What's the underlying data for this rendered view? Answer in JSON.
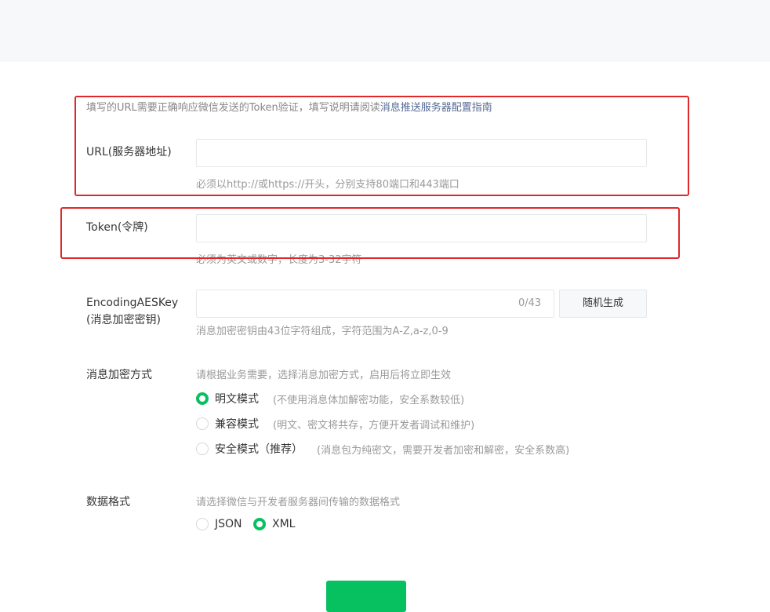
{
  "intro": {
    "text": "填写的URL需要正确响应微信发送的Token验证，填写说明请阅读",
    "link": "消息推送服务器配置指南"
  },
  "url_field": {
    "label": "URL(服务器地址)",
    "value": "",
    "hint": "必须以http://或https://开头，分别支持80端口和443端口"
  },
  "token_field": {
    "label": "Token(令牌)",
    "value": "",
    "hint": "必须为英文或数字，长度为3-32字符"
  },
  "aes_field": {
    "label_line1": "EncodingAESKey",
    "label_line2": "(消息加密密钥)",
    "value": "",
    "counter": "0/43",
    "generate_label": "随机生成",
    "hint": "消息加密密钥由43位字符组成，字符范围为A-Z,a-z,0-9"
  },
  "encrypt_mode": {
    "label": "消息加密方式",
    "hint": "请根据业务需要，选择消息加密方式，启用后将立即生效",
    "options": [
      {
        "label": "明文模式",
        "desc": "(不使用消息体加解密功能，安全系数较低)",
        "checked": true
      },
      {
        "label": "兼容模式",
        "desc": "(明文、密文将共存，方便开发者调试和维护)",
        "checked": false
      },
      {
        "label": "安全模式（推荐）",
        "desc": "(消息包为纯密文，需要开发者加密和解密，安全系数高)",
        "checked": false
      }
    ]
  },
  "data_format": {
    "label": "数据格式",
    "hint": "请选择微信与开发者服务器间传输的数据格式",
    "options": [
      {
        "label": "JSON",
        "checked": false
      },
      {
        "label": "XML",
        "checked": true
      }
    ]
  },
  "colors": {
    "accent": "#07c160",
    "link": "#576b95",
    "highlight": "#e0282a"
  }
}
